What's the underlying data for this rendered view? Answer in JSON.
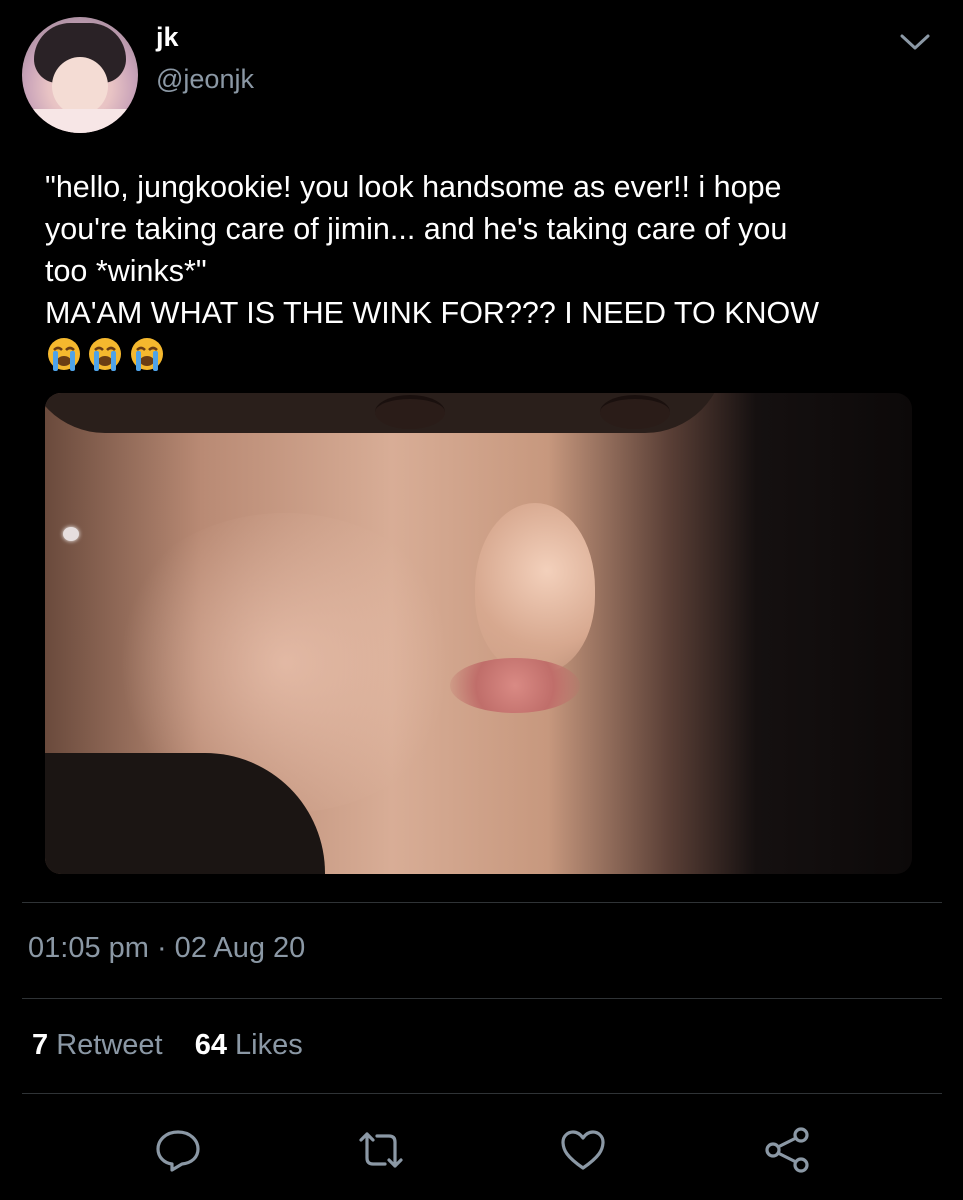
{
  "user": {
    "display_name": "jk",
    "handle": "@jeonjk"
  },
  "tweet": {
    "lines": [
      "\"hello, jungkookie! you look handsome as ever!! i hope",
      "you're taking care of jimin... and he's taking care of you",
      "too *winks*\"",
      "MA'AM WHAT IS THE WINK FOR??? I NEED TO KNOW"
    ],
    "emojis": [
      "loudly-crying-face-emoji",
      "loudly-crying-face-emoji",
      "loudly-crying-face-emoji"
    ]
  },
  "meta": {
    "timestamp": "01:05 pm · 02 Aug 20"
  },
  "stats": {
    "retweet_count": "7",
    "retweet_label": "Retweet",
    "like_count": "64",
    "like_label": "Likes"
  },
  "actions": [
    "reply-icon",
    "retweet-icon",
    "like-icon",
    "share-icon"
  ],
  "colors": {
    "background": "#000000",
    "secondary_text": "#8b98a5",
    "divider": "#2f3336"
  }
}
